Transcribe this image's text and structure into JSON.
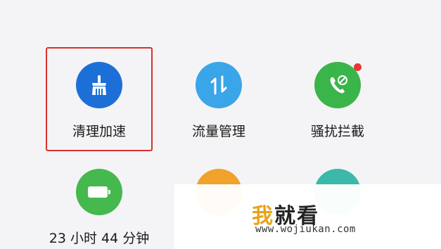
{
  "grid": {
    "items": [
      {
        "label": "清理加速",
        "icon": "broom-icon",
        "color": "#1d6fd8"
      },
      {
        "label": "流量管理",
        "icon": "transfer-arrows-icon",
        "color": "#3aa5e8"
      },
      {
        "label": "骚扰拦截",
        "icon": "blocked-call-icon",
        "color": "#3ab54a"
      },
      {
        "label": "23 小时 44 分钟",
        "icon": "battery-icon",
        "color": "#45b84e"
      },
      {
        "label": "",
        "icon": "app-icon",
        "color": "#f1a22a"
      },
      {
        "label": "",
        "icon": "app-icon",
        "color": "#3cb8a8"
      }
    ]
  },
  "watermark": {
    "title_first": "我",
    "title_rest": "就看",
    "url": "www.wojiukan.com"
  }
}
